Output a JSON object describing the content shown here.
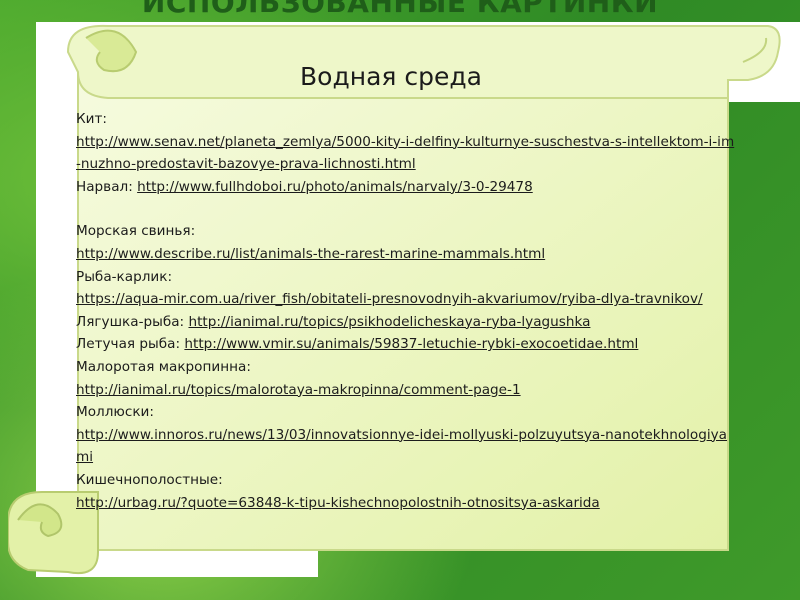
{
  "page_title": "ИСПОЛЬЗОВАННЫЕ КАРТИНКИ",
  "section_heading": "Водная среда",
  "entries": [
    {
      "label": "Кит:",
      "url": "http://www.senav.net/planeta_zemlya/5000-kity-i-delfiny-kulturnye-suschestva-s-intellektom-i-im-nuzhno-predostavit-bazovye-prava-lichnosti.html"
    },
    {
      "label": "Нарвал:",
      "url": "http://www.fullhdoboi.ru/photo/animals/narvaly/3-0-29478"
    },
    {
      "label": "Морская свинья:",
      "url": "http://www.describe.ru/list/animals-the-rarest-marine-mammals.html"
    },
    {
      "label": "Рыба-карлик:",
      "url": "https://aqua-mir.com.ua/river_fish/obitateli-presnovodnyih-akvariumov/ryiba-dlya-travnikov/"
    },
    {
      "label": "Лягушка-рыба:",
      "url": "http://ianimal.ru/topics/psikhodelicheskaya-ryba-lyagushka"
    },
    {
      "label": "Летучая рыба:",
      "url": "http://www.vmir.su/animals/59837-letuchie-rybki-exocoetidae.html"
    },
    {
      "label": "Малоротая макропинна:",
      "url": "http://ianimal.ru/topics/malorotaya-makropinna/comment-page-1"
    },
    {
      "label": "Моллюски:",
      "url": "http://www.innoros.ru/news/13/03/innovatsionnye-idei-mollyuski-polzuyutsya-nanotekhnologiyami"
    },
    {
      "label": "Кишечнополостные:",
      "url": "http://urbag.ru/?quote=63848-k-tipu-kishechnopolostnih-otnositsya-askarida"
    }
  ],
  "colors": {
    "background": "#3f9a2a",
    "scroll_fill": "#eef7c9",
    "scroll_edge": "#c9d98a",
    "title": "#1f5e19"
  }
}
